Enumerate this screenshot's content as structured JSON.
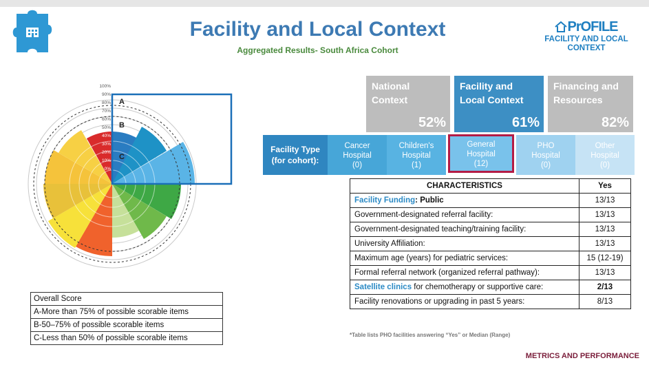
{
  "header": {
    "title": "Facility and Local Context",
    "subtitle": "Aggregated Results- South Africa Cohort"
  },
  "logo": {
    "mark": "PrOFILE",
    "line1": "FACILITY AND LOCAL",
    "line2": "CONTEXT"
  },
  "chart": {
    "ring_labels": [
      "100%",
      "90%",
      "80%",
      "70%",
      "60%",
      "50%",
      "40%",
      "30%",
      "20%",
      "10%",
      "0%"
    ],
    "zone_labels": [
      "A",
      "B",
      "C"
    ]
  },
  "legend": {
    "title": "Overall Score",
    "rows": [
      "A-More than 75% of possible scorable items",
      "B-50–75% of possible scorable items",
      "C-Less than 50% of possible scorable items"
    ]
  },
  "domains": [
    {
      "name_line1": "National",
      "name_line2": "Context",
      "pct": "52%",
      "color": "#bdbdbd"
    },
    {
      "name_line1": "Facility and",
      "name_line2": "Local Context",
      "pct": "61%",
      "color": "#3d8fc4"
    },
    {
      "name_line1": "Financing and",
      "name_line2": "Resources",
      "pct": "82%",
      "color": "#bdbdbd"
    }
  ],
  "facility_type": {
    "label_line1": "Facility Type",
    "label_line2": "(for cohort):",
    "types": [
      {
        "line1": "Cancer",
        "line2": "Hospital",
        "count": "(0)",
        "color": "#47a6d8"
      },
      {
        "line1": "Children's",
        "line2": "Hospital",
        "count": "(1)",
        "color": "#58b3e2"
      },
      {
        "line1": "General",
        "line2": "Hospital",
        "count": "(12)",
        "color": "#79c2eb",
        "highlight": true
      },
      {
        "line1": "PHO",
        "line2": "Hospital",
        "count": "(0)",
        "color": "#9fd2f0"
      },
      {
        "line1": "Other",
        "line2": "Hospital",
        "count": "(0)",
        "color": "#c6e3f5"
      }
    ]
  },
  "characteristics": {
    "header_left": "CHARACTERISTICS",
    "header_right": "Yes",
    "rows": [
      {
        "label_pre": "Facility Funding",
        "label_post": ": Public",
        "value": "13/13"
      },
      {
        "label": "Government-designated referral facility:",
        "value": "13/13"
      },
      {
        "label": "Government-designated teaching/training facility:",
        "value": "13/13"
      },
      {
        "label": "University Affiliation:",
        "value": "13/13"
      },
      {
        "label": "Maximum age (years) for pediatric services:",
        "value": "15 (12-19)"
      },
      {
        "label": "Formal referral network (organized referral pathway):",
        "value": "13/13"
      },
      {
        "label": "Satellite clinics",
        "label_post": " for chemotherapy or supportive care:",
        "value": "2/13"
      },
      {
        "label": "Facility renovations or upgrading in past 5 years:",
        "value": "8/13"
      }
    ]
  },
  "footnote": "*Table lists PHO facilities answering “Yes” or Median (Range)",
  "footer": "METRICS AND PERFORMANCE"
}
